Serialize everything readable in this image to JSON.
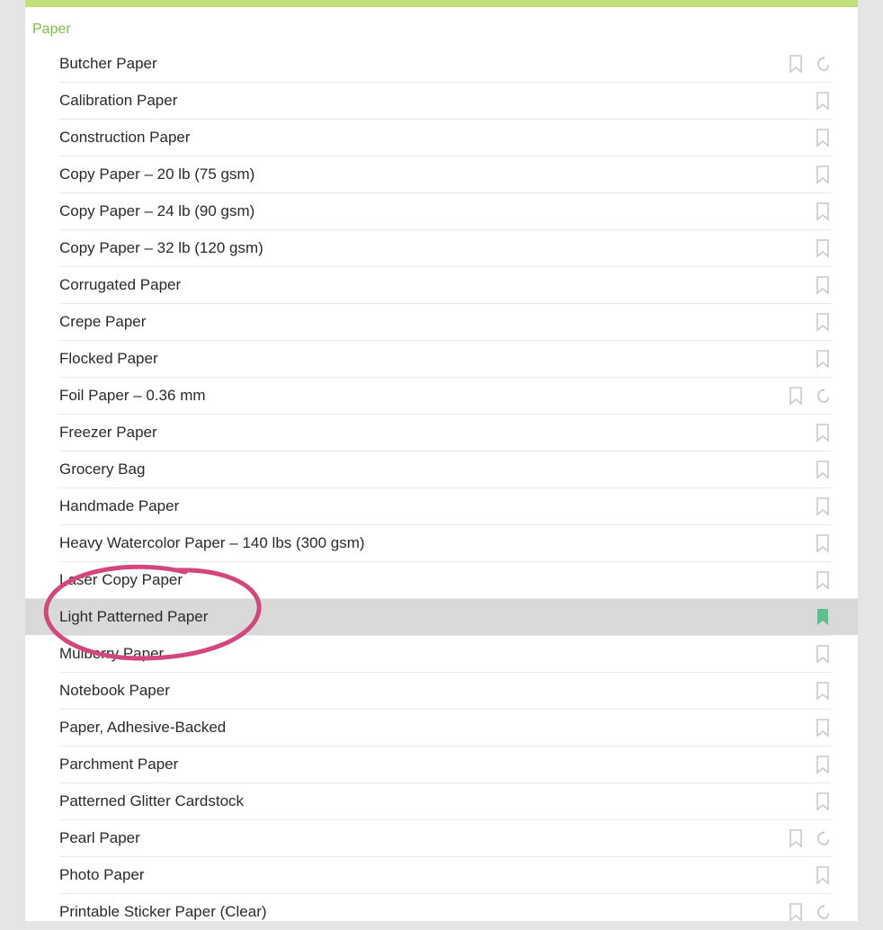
{
  "category_label": "Paper",
  "materials": [
    {
      "label": "Butcher Paper",
      "bookmarked": false,
      "has_logo": true
    },
    {
      "label": "Calibration Paper",
      "bookmarked": false,
      "has_logo": false
    },
    {
      "label": "Construction Paper",
      "bookmarked": false,
      "has_logo": false
    },
    {
      "label": "Copy Paper – 20 lb (75 gsm)",
      "bookmarked": false,
      "has_logo": false
    },
    {
      "label": "Copy Paper – 24 lb (90 gsm)",
      "bookmarked": false,
      "has_logo": false
    },
    {
      "label": "Copy Paper – 32 lb (120 gsm)",
      "bookmarked": false,
      "has_logo": false
    },
    {
      "label": "Corrugated Paper",
      "bookmarked": false,
      "has_logo": false
    },
    {
      "label": "Crepe Paper",
      "bookmarked": false,
      "has_logo": false
    },
    {
      "label": "Flocked Paper",
      "bookmarked": false,
      "has_logo": false
    },
    {
      "label": "Foil Paper – 0.36 mm",
      "bookmarked": false,
      "has_logo": true
    },
    {
      "label": "Freezer Paper",
      "bookmarked": false,
      "has_logo": false
    },
    {
      "label": "Grocery Bag",
      "bookmarked": false,
      "has_logo": false
    },
    {
      "label": "Handmade Paper",
      "bookmarked": false,
      "has_logo": false
    },
    {
      "label": "Heavy Watercolor Paper – 140 lbs (300 gsm)",
      "bookmarked": false,
      "has_logo": false
    },
    {
      "label": "Laser Copy Paper",
      "bookmarked": false,
      "has_logo": false
    },
    {
      "label": "Light Patterned Paper",
      "bookmarked": true,
      "has_logo": false,
      "selected": true
    },
    {
      "label": "Mulberry Paper",
      "bookmarked": false,
      "has_logo": false
    },
    {
      "label": "Notebook Paper",
      "bookmarked": false,
      "has_logo": false
    },
    {
      "label": "Paper, Adhesive-Backed",
      "bookmarked": false,
      "has_logo": false
    },
    {
      "label": "Parchment Paper",
      "bookmarked": false,
      "has_logo": false
    },
    {
      "label": "Patterned Glitter Cardstock",
      "bookmarked": false,
      "has_logo": false
    },
    {
      "label": "Pearl Paper",
      "bookmarked": false,
      "has_logo": true
    },
    {
      "label": "Photo Paper",
      "bookmarked": false,
      "has_logo": false
    },
    {
      "label": "Printable Sticker Paper (Clear)",
      "bookmarked": false,
      "has_logo": true
    }
  ]
}
